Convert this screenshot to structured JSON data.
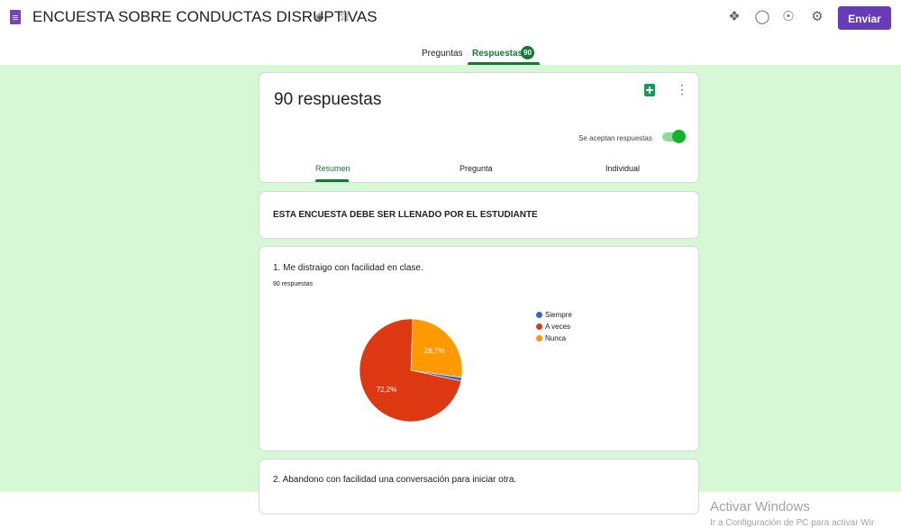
{
  "header": {
    "title": "ENCUESTA SOBRE CONDUCTAS DISRUPTIVAS",
    "send_label": "Enviar",
    "accent": "#673ab7"
  },
  "tabs": {
    "questions_label": "Preguntas",
    "responses_label": "Respuestas",
    "responses_count": "90",
    "active_color": "#0f7b34"
  },
  "summary": {
    "count_title": "90 respuestas",
    "accepting_label": "Se aceptan respuestas",
    "accepting": true,
    "subtabs": [
      "Resumen",
      "Pregunta",
      "Individual"
    ],
    "active_subtab": "Resumen"
  },
  "description": {
    "text": "ESTA ENCUESTA DEBE SER LLENADO POR EL ESTUDIANTE"
  },
  "question1": {
    "title": "1. Me distraigo con facilidad en clase.",
    "count": "90 respuestas",
    "chart_data": {
      "type": "pie",
      "categories": [
        "Siempre",
        "A veces",
        "Nunca"
      ],
      "values": [
        1.1,
        72.2,
        26.7
      ],
      "labels": [
        "",
        "72,2%",
        "26,7%"
      ],
      "colors": [
        "#3366cc",
        "#dc3912",
        "#ff9900"
      ],
      "legend": "right"
    }
  },
  "question2": {
    "title": "2. Abandono con facilidad una conversación para iniciar otra."
  },
  "background_color": "#d7f8d5",
  "watermark": {
    "line1": "Activar Windows",
    "line2": "Ir a Configuración de PC para activar Wir"
  }
}
